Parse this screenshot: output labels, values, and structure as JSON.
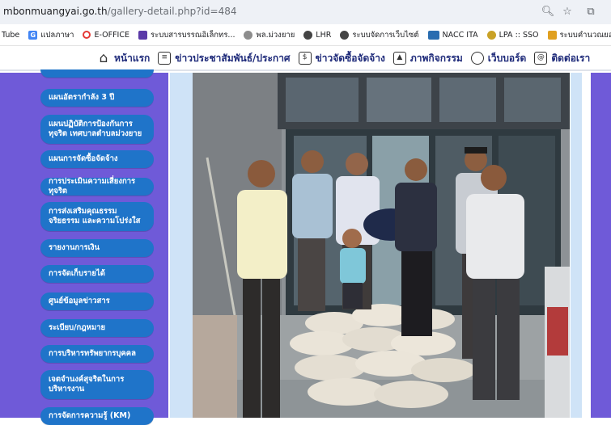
{
  "browser": {
    "url_host": "mbonmuangyai.go.th",
    "url_path": "/gallery-detail.php?id=484",
    "icons": [
      "search-icon",
      "star-icon",
      "extensions-icon"
    ]
  },
  "bookmarks": [
    {
      "label": "Tube",
      "icon": "youtube-icon",
      "color": "#ff0000"
    },
    {
      "label": "แปลภาษา",
      "icon": "translate-icon",
      "color": "#4285f4"
    },
    {
      "label": "E-OFFICE",
      "icon": "eoffice-icon",
      "color": "#e53935"
    },
    {
      "label": "ระบบสารบรรณอิเล็กทร...",
      "icon": "doc-icon",
      "color": "#5b3aa8"
    },
    {
      "label": "พล.ม่วงยาย",
      "icon": "seal-icon",
      "color": "#7a7a7a"
    },
    {
      "label": "LHR",
      "icon": "globe-icon",
      "color": "#444444"
    },
    {
      "label": "ระบบจัดการเว็บไซต์",
      "icon": "globe-icon",
      "color": "#444444"
    },
    {
      "label": "NACC ITA",
      "icon": "nacc-icon",
      "color": "#2a6db0"
    },
    {
      "label": "LPA :: SSO",
      "icon": "lpa-icon",
      "color": "#c9a227"
    },
    {
      "label": "ระบบคำนวณยอดยยการ...",
      "icon": "chart-icon",
      "color": "#e0a020"
    }
  ],
  "sitenav": [
    {
      "label": "หน้าแรก",
      "icon": "home-icon",
      "glyph": "⌂"
    },
    {
      "label": "ข่าวประชาสัมพันธ์/ประกาศ",
      "icon": "news-icon",
      "glyph": "▤"
    },
    {
      "label": "ข่าวจัดซื้อจัดจ้าง",
      "icon": "procurement-icon",
      "glyph": "$"
    },
    {
      "label": "ภาพกิจกรรม",
      "icon": "gallery-icon",
      "glyph": "▲"
    },
    {
      "label": "เว็บบอร์ด",
      "icon": "webboard-icon",
      "glyph": "☐"
    },
    {
      "label": "ติดต่อเรา",
      "icon": "contact-icon",
      "glyph": "@"
    }
  ],
  "sidebar": [
    {
      "label": "แผนอัตรากำลัง 3 ปี"
    },
    {
      "label": "แผนปฏิบัติการป้องกันการทุจริต เทศบาลตำบลม่วงยาย"
    },
    {
      "label": "แผนการจัดซื้อจัดจ้าง"
    },
    {
      "label": "การประเมินความเสี่ยงการทุจริต"
    },
    {
      "label": "การส่งเสริมคุณธรรม จริยธรรม และความโปร่งใส"
    },
    {
      "label": "รายงานการเงิน"
    },
    {
      "label": "การจัดเก็บรายได้"
    },
    {
      "label": "ศูนย์ข้อมูลข่าวสาร"
    },
    {
      "label": "ระเบียบ/กฎหมาย"
    },
    {
      "label": "การบริหารทรัพยากรบุคคล"
    },
    {
      "label": "เจตจำนงค์สุจริตในการบริหารงาน"
    },
    {
      "label": "การจัดการความรู้ (KM)"
    }
  ],
  "gallery": {
    "photo_alt": "gallery-photo"
  }
}
